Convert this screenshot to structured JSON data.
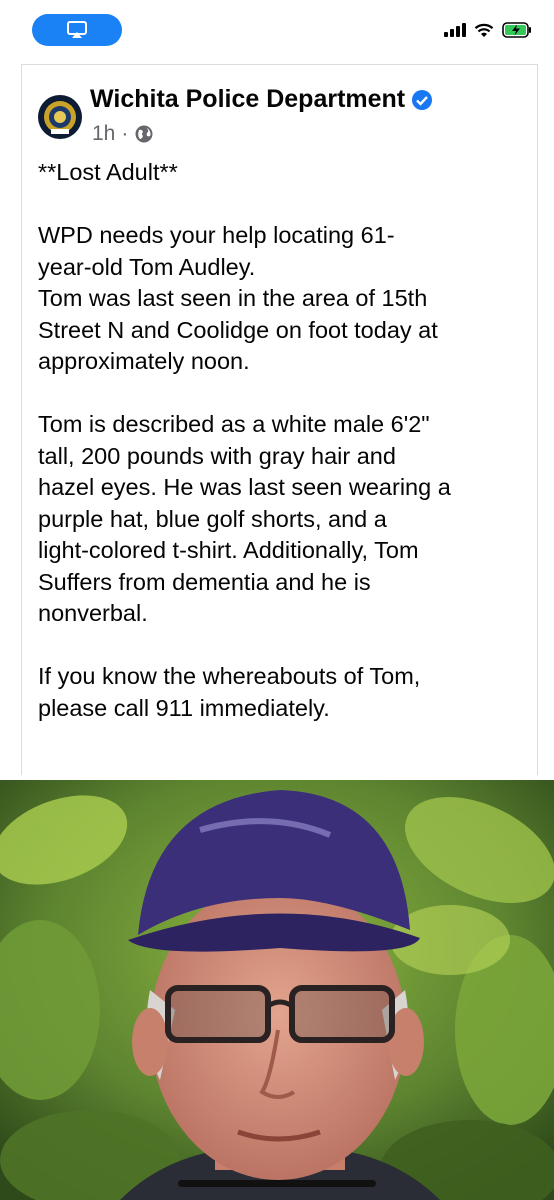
{
  "status_bar": {
    "screen_mirroring_icon": "screen-mirroring-icon",
    "signal_icon": "cellular-signal-icon",
    "wifi_icon": "wifi-icon",
    "battery_icon": "battery-charging-icon",
    "pill_color": "#1a82f5"
  },
  "post": {
    "page_name": "Wichita Police Department",
    "verified_icon": "verified-badge-icon",
    "time": "1h",
    "separator": "·",
    "audience_icon": "globe-icon",
    "lines": [
      "**Lost Adult**",
      "",
      "WPD needs your help locating 61-",
      "year-old Tom Audley.",
      "Tom was last seen in the area of 15th",
      "Street N and Coolidge on foot today at",
      "approximately noon.",
      "",
      "Tom is described as a white male 6'2\"",
      "tall, 200 pounds with gray hair and",
      "hazel eyes. He was last seen wearing a",
      "purple hat, blue golf shorts, and a",
      "light-colored t-shirt.  Additionally, Tom",
      "Suffers from dementia and he is",
      "nonverbal.",
      "",
      "If you know the whereabouts of Tom,",
      "please call 911 immediately."
    ]
  },
  "photo": {
    "subject": "man in purple cap and glasses against green leaves"
  },
  "colors": {
    "verified_blue": "#1877f2",
    "meta_gray": "#65676b",
    "cap_purple": "#3b2f7a"
  }
}
